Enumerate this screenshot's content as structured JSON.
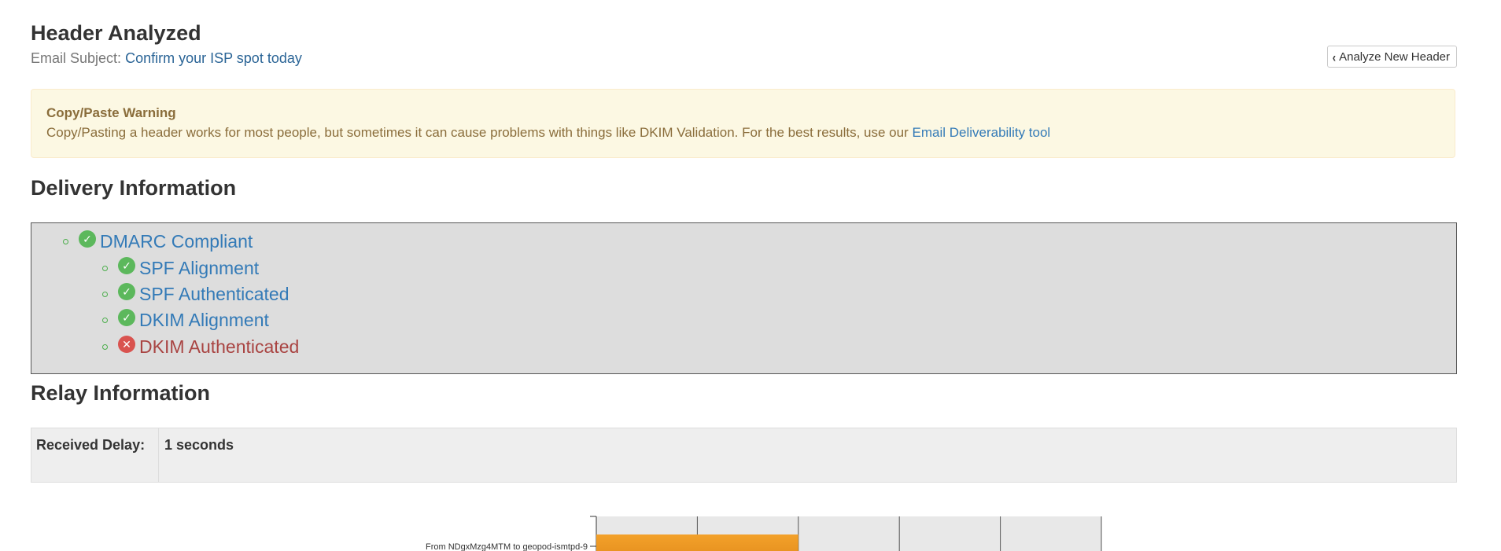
{
  "header": {
    "title": "Header Analyzed",
    "subject_label": "Email Subject:",
    "subject_value": "Confirm your ISP spot today",
    "analyze_button": "Analyze New Header"
  },
  "warning": {
    "title": "Copy/Paste Warning",
    "text": "Copy/Pasting a header works for most people, but sometimes it can cause problems with things like DKIM Validation. For the best results, use our ",
    "link_text": "Email Deliverability tool"
  },
  "delivery": {
    "section_title": "Delivery Information",
    "items": [
      {
        "label": "DMARC Compliant",
        "status": "pass",
        "level": 0
      },
      {
        "label": "SPF Alignment",
        "status": "pass",
        "level": 1
      },
      {
        "label": "SPF Authenticated",
        "status": "pass",
        "level": 1
      },
      {
        "label": "DKIM Alignment",
        "status": "pass",
        "level": 1
      },
      {
        "label": "DKIM Authenticated",
        "status": "fail",
        "level": 1
      }
    ]
  },
  "relay": {
    "section_title": "Relay Information",
    "received_delay_label": "Received Delay:",
    "received_delay_value": "1 seconds"
  },
  "chart_data": {
    "type": "bar",
    "orientation": "horizontal",
    "categories": [
      "From NDgxMzg4MTM to geopod-ismtpd-9"
    ],
    "values": [
      2
    ],
    "xlim": [
      0,
      5
    ],
    "grid": true,
    "colors": {
      "bar": "#e8951e",
      "plot_bg": "#e8e8e8"
    }
  },
  "colors": {
    "link": "#337ab7",
    "pass": "#5cb85c",
    "fail": "#d9534f",
    "warning_bg": "#fcf8e3",
    "warning_text": "#8a6d3b"
  }
}
